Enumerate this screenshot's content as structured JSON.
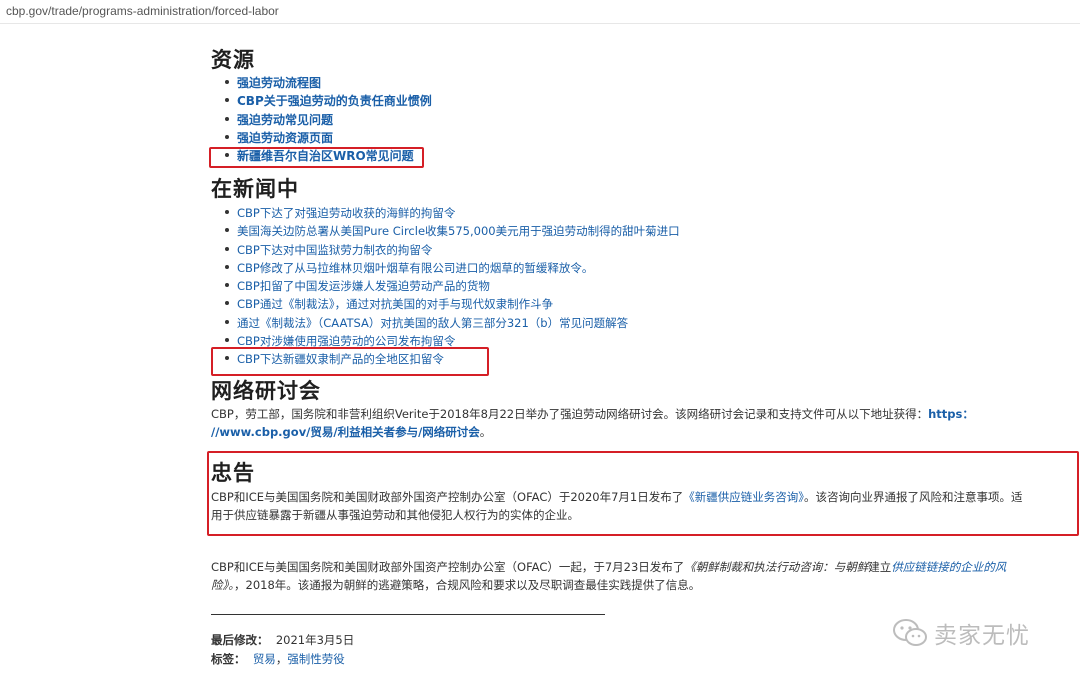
{
  "url": "cbp.gov/trade/programs-administration/forced-labor",
  "resources": {
    "heading": "资源",
    "items": [
      "强迫劳动流程图",
      "CBP关于强迫劳动的负责任商业惯例",
      "强迫劳动常见问题",
      "强迫劳动资源页面",
      "新疆维吾尔自治区WRO常见问题"
    ]
  },
  "news": {
    "heading": "在新闻中",
    "items": [
      "CBP下达了对强迫劳动收获的海鲜的拘留令",
      "美国海关边防总署从美国Pure Circle收集575,000美元用于强迫劳动制得的甜叶菊进口",
      "CBP下达对中国监狱劳力制衣的拘留令",
      "CBP修改了从马拉维林贝烟叶烟草有限公司进口的烟草的暂缓释放令。",
      "CBP扣留了中国发运涉嫌人发强迫劳动产品的货物",
      "CBP通过《制裁法》，通过对抗美国的对手与现代奴隶制作斗争",
      "通过《制裁法》（CAATSA）对抗美国的敌人第三部分321（b）常见问题解答",
      "CBP对涉嫌使用强迫劳动的公司发布拘留令",
      "CBP下达新疆奴隶制产品的全地区扣留令"
    ]
  },
  "webinar": {
    "heading": "网络研讨会",
    "text": "CBP，劳工部，国务院和非营利组织Verite于2018年8月22日举办了强迫劳动网络研讨会。该网络研讨会记录和支持文件可从以下地址获得：",
    "link_a": "https：",
    "link_b": "//www.cbp.gov/贸易/利益相关者参与/网络研讨会",
    "tail": "。"
  },
  "advisory": {
    "heading": "忠告",
    "p1_pre": "CBP和ICE与美国国务院和美国财政部外国资产控制办公室（OFAC）于2020年7月1日发布了",
    "p1_link": "《新疆供应链业务咨询》",
    "p1_mid": "。该咨询向业界通报了风险和注意事项。适",
    "p1_line2": "用于供应链暴露于新疆从事强迫劳动和其他侵犯人权行为的实体的企业。",
    "p2_pre": "CBP和ICE与美国国务院和美国财政部外国资产控制办公室（OFAC）一起，于7月23日发布了",
    "p2_it1": "《朝鲜制裁和执法行动咨询：与朝鲜",
    "p2_mid": "建立",
    "p2_link": "供应链链接的企业的风",
    "p2_line2_it": "险》。",
    "p2_line2_rest": "，2018年。该通报为朝鲜的逃避策略，合规风险和要求以及尽职调查最佳实践提供了信息。"
  },
  "footer": {
    "last_modified_label": "最后修改：",
    "last_modified_value": "2021年3月5日",
    "tags_label": "标签：",
    "tag1": "贸易",
    "tag_sep": "，",
    "tag2": "强制性劳役"
  },
  "watermark": {
    "text": "卖家无忧",
    "icon": "wechat-icon"
  },
  "colors": {
    "link": "#1a5fa8",
    "highlight_box": "#d51f26"
  }
}
